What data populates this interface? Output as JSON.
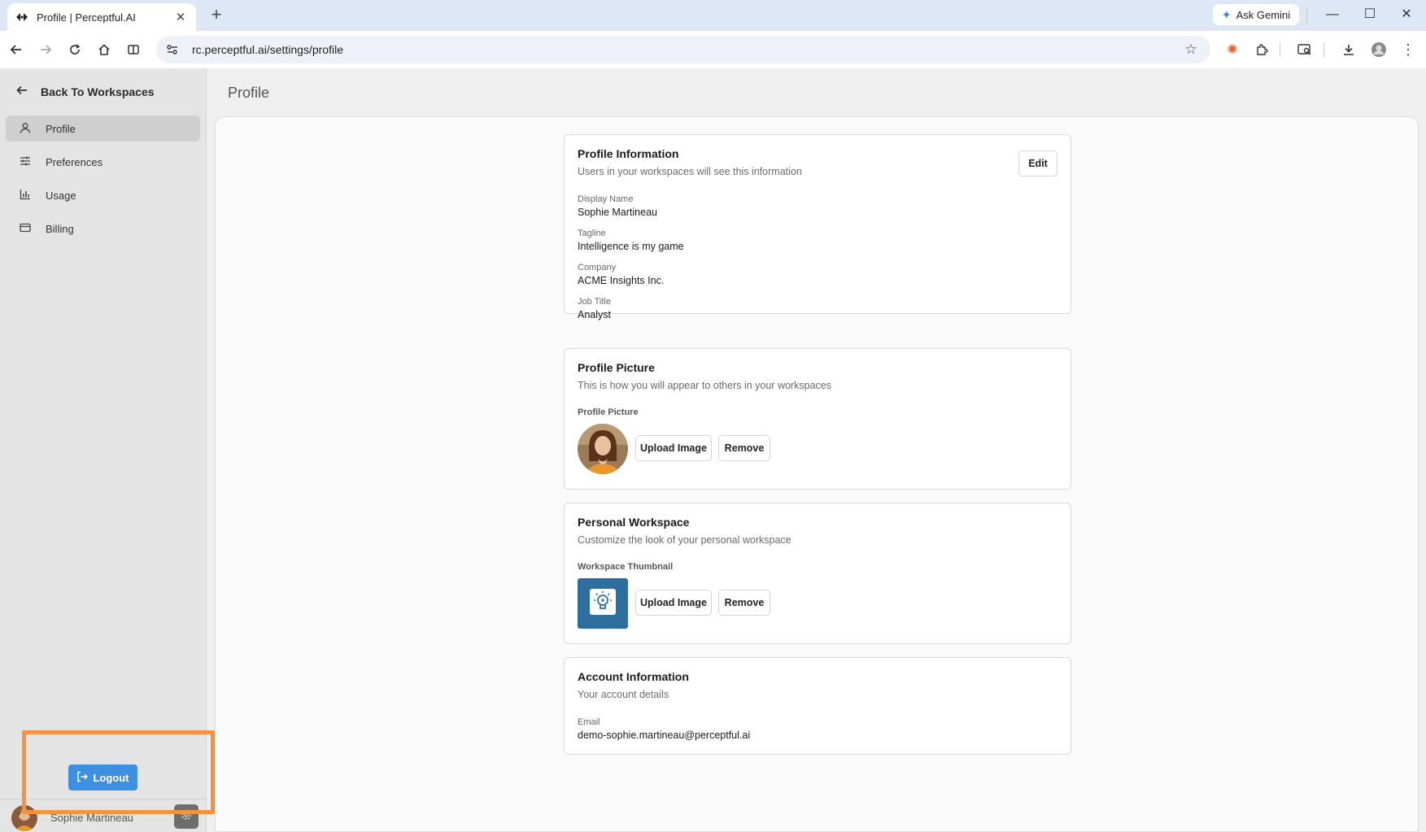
{
  "browser": {
    "tab_title": "Profile | Perceptful.AI",
    "tab_close": "✕",
    "new_tab": "+",
    "gemini_label": "Ask Gemini",
    "url": "rc.perceptful.ai/settings/profile"
  },
  "sidebar": {
    "back_label": "Back To Workspaces",
    "items": [
      {
        "label": "Profile",
        "icon": "person-icon",
        "active": true
      },
      {
        "label": "Preferences",
        "icon": "sliders-icon",
        "active": false
      },
      {
        "label": "Usage",
        "icon": "bar-chart-icon",
        "active": false
      },
      {
        "label": "Billing",
        "icon": "credit-card-icon",
        "active": false
      }
    ],
    "logout_label": "Logout",
    "user_name": "Sophie Martineau"
  },
  "page": {
    "title": "Profile"
  },
  "profile_info": {
    "title": "Profile Information",
    "subtitle": "Users in your workspaces will see this information",
    "edit_label": "Edit",
    "fields": [
      {
        "label": "Display Name",
        "value": "Sophie Martineau"
      },
      {
        "label": "Tagline",
        "value": "Intelligence is my game"
      },
      {
        "label": "Company",
        "value": "ACME Insights Inc."
      },
      {
        "label": "Job Title",
        "value": "Analyst"
      }
    ]
  },
  "profile_picture": {
    "title": "Profile Picture",
    "subtitle": "This is how you will appear to others in your workspaces",
    "field_label": "Profile Picture",
    "upload_label": "Upload Image",
    "remove_label": "Remove"
  },
  "personal_workspace": {
    "title": "Personal Workspace",
    "subtitle": "Customize the look of your personal workspace",
    "field_label": "Workspace Thumbnail",
    "upload_label": "Upload Image",
    "remove_label": "Remove",
    "thumbnail_color": "#2d6e9e"
  },
  "account_info": {
    "title": "Account Information",
    "subtitle": "Your account details",
    "email_label": "Email",
    "email_value": "demo-sophie.martineau@perceptful.ai"
  },
  "colors": {
    "accent": "#3d8fe0",
    "highlight": "#f3923f"
  }
}
